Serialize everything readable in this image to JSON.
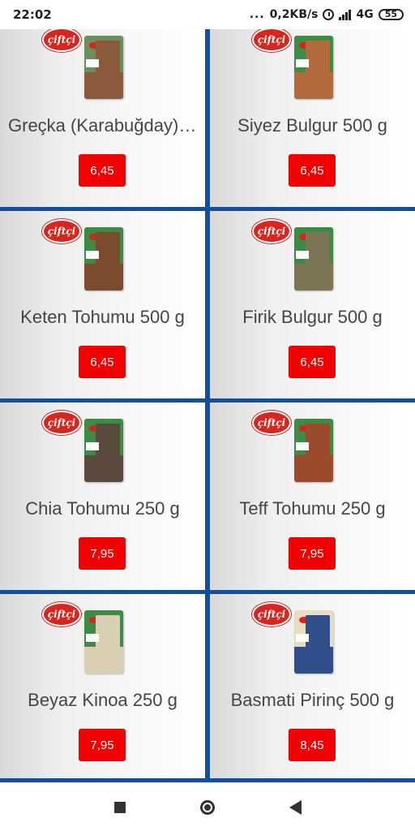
{
  "status_bar": {
    "time": "22:02",
    "dots": "...",
    "network_speed": "0,2KB/s",
    "network_type": "4G",
    "battery": "55"
  },
  "products": [
    {
      "name": "Greçka (Karabuğday) 5...",
      "price": "6,45",
      "pack_top": "#6a8f5a",
      "pack_bottom": "#8b5a3c"
    },
    {
      "name": "Siyez Bulgur 500 g",
      "price": "6,45",
      "pack_top": "#3c8d48",
      "pack_bottom": "#b36b3e"
    },
    {
      "name": "Keten Tohumu 500 g",
      "price": "6,45",
      "pack_top": "#3b8a45",
      "pack_bottom": "#7a4b2e"
    },
    {
      "name": "Firik Bulgur 500 g",
      "price": "6,45",
      "pack_top": "#3b8a45",
      "pack_bottom": "#7c7555"
    },
    {
      "name": "Chia Tohumu 250 g",
      "price": "7,95",
      "pack_top": "#3e8a47",
      "pack_bottom": "#5a4a3e"
    },
    {
      "name": "Teff Tohumu 250 g",
      "price": "7,95",
      "pack_top": "#3e8a47",
      "pack_bottom": "#9c4a2c"
    },
    {
      "name": "Beyaz Kinoa 250 g",
      "price": "7,95",
      "pack_top": "#3e8a47",
      "pack_bottom": "#d9cfb2"
    },
    {
      "name": "Basmati Pirinç 500 g",
      "price": "8,45",
      "pack_top": "#e8dcc2",
      "pack_bottom": "#2f4e8a"
    }
  ],
  "brand": "çiftçi",
  "colors": {
    "grid_background": "#154f95",
    "price_button": "#f10000",
    "brand_red": "#d7261f"
  },
  "nav": {
    "recents_icon": "square-icon",
    "home_icon": "circle-icon",
    "back_icon": "back-triangle-icon"
  }
}
